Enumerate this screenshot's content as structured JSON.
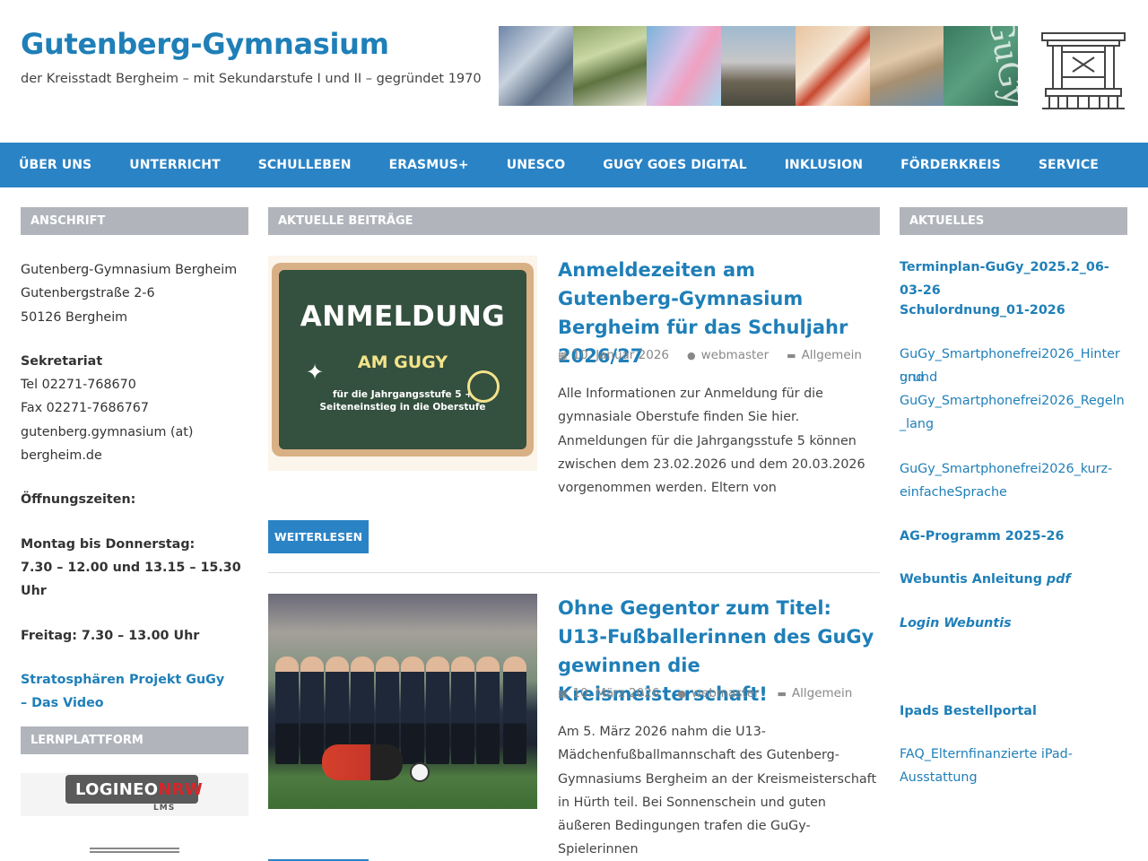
{
  "header": {
    "title": "Gutenberg-Gymnasium",
    "description": "der Kreisstadt Bergheim – mit Sekundarstufe I und II – gegründet 1970",
    "banner_text": "GuGy"
  },
  "nav": {
    "items": [
      "Über uns",
      "Unterricht",
      "Schulleben",
      "Erasmus+",
      "UNESCO",
      "GuGy goes digital",
      "Inklusion",
      "Förderkreis",
      "Service"
    ]
  },
  "left_sidebar": {
    "heading_address": "Anschrift",
    "address": [
      "Gutenberg-Gymnasium Bergheim",
      "Gutenbergstraße 2-6",
      "50126 Bergheim"
    ],
    "secretariat_label": "Sekretariat",
    "tel": "Tel 02271-768670",
    "fax": "Fax 02271-7686767",
    "email_line1": "gutenberg.gymnasium (at)",
    "email_line2": "bergheim.de",
    "hours_label": "Öffnungszeiten:",
    "mon_thu_label": "Montag bis Donnerstag:",
    "mon_thu_hours": "7.30 – 12.00 und 13.15 – 15.30 Uhr",
    "friday": "Freitag:  7.30 – 13.00 Uhr",
    "video_link_1": "Stratosphären Projekt GuGy",
    "video_link_2": "– Das Video",
    "heading_platform": "Lernplattform",
    "logineo_a": "LOGINEO",
    "logineo_b": "NRW",
    "logineo_sub": "LMS"
  },
  "main": {
    "heading": "Aktuelle Beiträge",
    "read_more": "Weiterlesen",
    "posts": [
      {
        "title": "Anmeldezeiten am Gutenberg-Gymnasium Bergheim für das Schuljahr 2026/27",
        "date": "10. Januar 2026",
        "author": "webmaster",
        "category": "Allgemein",
        "excerpt": "Alle Informationen zur Anmeldung für die gymnasiale Oberstufe finden Sie hier. Anmeldungen für die Jahrgangsstufe 5 können zwischen dem 23.02.2026 und dem 20.03.2026 vorgenommen werden. Eltern von",
        "image": {
          "headline": "ANMELDUNG",
          "subline": "AM GUGY",
          "small_1": "für die Jahrgangsstufe 5 +",
          "small_2": "Seiteneinstieg in die Oberstufe"
        }
      },
      {
        "title": "Ohne Gegentor zum Titel: U13-Fußballerinnen des GuGy gewinnen die Kreismeisterschaft!",
        "date": "10. März 2026",
        "author": "webmaster",
        "category": "Allgemein",
        "excerpt": "Am 5. März 2026 nahm die U13-Mädchenfußballmannschaft des Gutenberg-Gymnasiums Bergheim an der Kreismeisterschaft in Hürth teil. Bei Sonnenschein und guten äußeren Bedingungen trafen die GuGy-Spielerinnen"
      }
    ]
  },
  "right_sidebar": {
    "heading": "Aktuelles",
    "links": [
      "Terminplan-GuGy_2025.2_06-03-26",
      "Schulordnung_01-2026",
      "GuGy_Smartphonefrei2026_Hintergrund",
      "GuGy_Smartphonefrei2026_Regeln_lang",
      "GuGy_Smartphonefrei2026_kurz-einfacheSprache",
      "AG-Programm 2025-26",
      "Webuntis Anleitung",
      "pdf",
      "Login Webuntis",
      "Ipads Bestellportal",
      "FAQ_Elternfinanzierte iPad-Ausstattung"
    ],
    "and_word": "und"
  }
}
